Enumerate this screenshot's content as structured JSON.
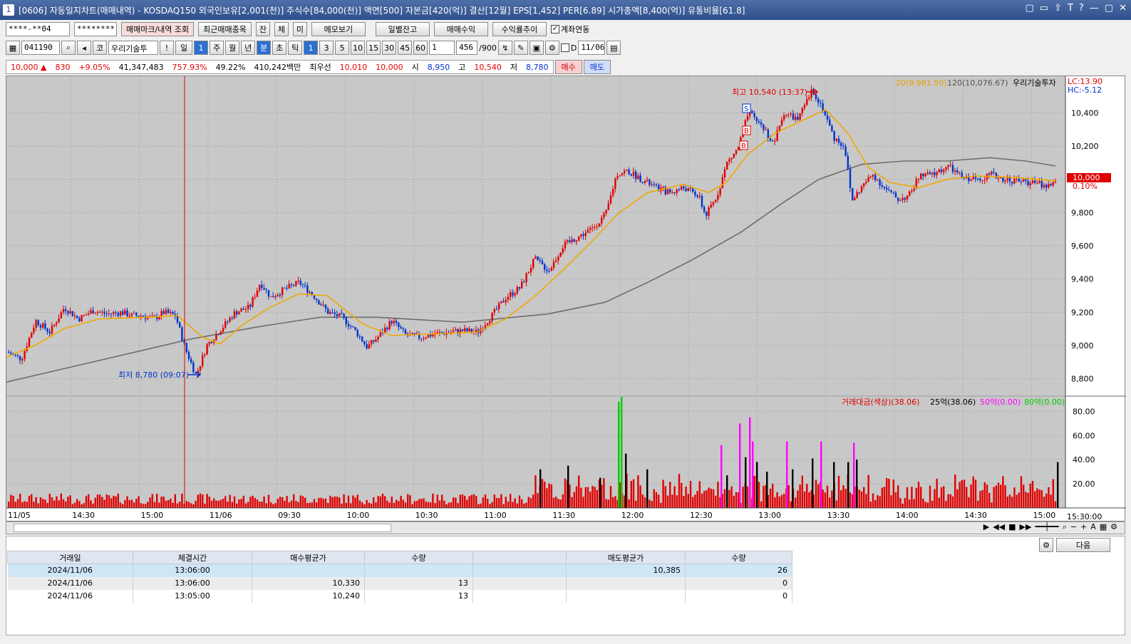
{
  "window": {
    "title": "[0606] 자동일지차트(매매내역) - KOSDAQ150 외국인보유[2,001(천)] 주식수[84,000(천)] 액면[500] 자본금[420(억)] 결산[12월] EPS[1,452] PER[6.89] 시가총액[8,400(억)] 유통비율[61.8]",
    "icon": "1",
    "controls": [
      "▢",
      "▭",
      "⇧",
      "T",
      "?",
      "—",
      "▢",
      "✕"
    ]
  },
  "toolbar1": {
    "account": "****-**04",
    "password": "********",
    "b1": "매매마크/내역 조회",
    "b2": "최근매매종목",
    "b3": "잔",
    "b4": "체",
    "b5": "미",
    "b6": "메모보기",
    "b7": "일별잔고",
    "b8": "매매수익",
    "b9": "수익률추이",
    "link_label": "계좌연동",
    "link_checked": "✓"
  },
  "toolbar2": {
    "code": "041190",
    "name": "우리기술투",
    "exclaim": "!",
    "period_day": "일",
    "period_num": "1",
    "week": "주",
    "month": "월",
    "year": "년",
    "minute": "분",
    "second": "초",
    "tick": "틱",
    "intervals": [
      "1",
      "3",
      "5",
      "10",
      "15",
      "30",
      "45",
      "60"
    ],
    "custom": "1",
    "count": "456",
    "total": "/900",
    "date_flag": "D",
    "date": "11/06",
    "code_btn": "코"
  },
  "quote": {
    "price": "10,000 ▲",
    "change": "830",
    "rate": "+9.05%",
    "volume": "41,347,483",
    "vol_rate": "757.93%",
    "ratio": "49.22%",
    "amount": "410,242백만",
    "best_label": "최우선",
    "best_ask": "10,010",
    "best_bid": "10,000",
    "open_label": "시",
    "open": "8,950",
    "high_label": "고",
    "high": "10,540",
    "low_label": "저",
    "low": "8,780",
    "buy": "매수",
    "sell": "매도"
  },
  "chart_data": {
    "type": "candlestick",
    "legend": {
      "ma20": "20(9,981.50)",
      "ma120": "120(10,076.67)",
      "broker": "우리기술투자",
      "lc": "LC:13.90",
      "hc": "HC:-5.12"
    },
    "price_ticks": [
      "10,400",
      "10,200",
      "10,000",
      "9,800",
      "9,600",
      "9,400",
      "9,200",
      "9,000",
      "8,800"
    ],
    "price_range": [
      8700,
      10620
    ],
    "current_label": "10,000",
    "current_rate": "0.10%",
    "high_annot": "최고 10,540 (13:37)",
    "low_annot": "최저 8,780 (09:07)",
    "volume_legend": {
      "main": "거래대금(색상)(38.06)",
      "s1": "25억(38.06)",
      "s2": "50억(0.00)",
      "s3": "80억(0.00)"
    },
    "volume_ticks": [
      "80.00",
      "60.00",
      "40.00",
      "20.00"
    ],
    "volume_range": [
      0,
      92
    ],
    "x_ticks": [
      "11/05",
      "14:30",
      "15:00",
      "11/06",
      "09:30",
      "10:00",
      "10:30",
      "11:00",
      "11:30",
      "12:00",
      "12:30",
      "13:00",
      "13:30",
      "14:00",
      "14:30",
      "15:00"
    ],
    "x_last": "15:30:00",
    "markers": {
      "s": "S",
      "b": "B"
    },
    "price_path": [
      [
        0,
        8960
      ],
      [
        20,
        8920
      ],
      [
        40,
        9150
      ],
      [
        60,
        9080
      ],
      [
        80,
        9230
      ],
      [
        100,
        9160
      ],
      [
        120,
        9210
      ],
      [
        140,
        9190
      ],
      [
        160,
        9200
      ],
      [
        175,
        9180
      ],
      [
        190,
        9180
      ],
      [
        205,
        9160
      ],
      [
        220,
        9200
      ],
      [
        236,
        9180
      ],
      [
        250,
        8980
      ],
      [
        265,
        8820
      ],
      [
        280,
        9000
      ],
      [
        300,
        9100
      ],
      [
        320,
        9200
      ],
      [
        340,
        9230
      ],
      [
        355,
        9380
      ],
      [
        370,
        9290
      ],
      [
        390,
        9340
      ],
      [
        410,
        9380
      ],
      [
        430,
        9300
      ],
      [
        450,
        9200
      ],
      [
        470,
        9170
      ],
      [
        490,
        9080
      ],
      [
        505,
        8990
      ],
      [
        520,
        9050
      ],
      [
        540,
        9150
      ],
      [
        560,
        9060
      ],
      [
        580,
        9050
      ],
      [
        600,
        9070
      ],
      [
        620,
        9080
      ],
      [
        640,
        9090
      ],
      [
        660,
        9080
      ],
      [
        680,
        9180
      ],
      [
        700,
        9290
      ],
      [
        720,
        9350
      ],
      [
        740,
        9520
      ],
      [
        760,
        9450
      ],
      [
        780,
        9600
      ],
      [
        800,
        9650
      ],
      [
        820,
        9700
      ],
      [
        840,
        9790
      ],
      [
        855,
        10030
      ],
      [
        870,
        10050
      ],
      [
        890,
        10000
      ],
      [
        910,
        9950
      ],
      [
        930,
        9920
      ],
      [
        950,
        9950
      ],
      [
        970,
        9900
      ],
      [
        980,
        9780
      ],
      [
        995,
        9890
      ],
      [
        1010,
        10100
      ],
      [
        1025,
        10180
      ],
      [
        1040,
        10400
      ],
      [
        1060,
        10320
      ],
      [
        1075,
        10210
      ],
      [
        1090,
        10400
      ],
      [
        1110,
        10360
      ],
      [
        1130,
        10540
      ],
      [
        1145,
        10420
      ],
      [
        1160,
        10250
      ],
      [
        1175,
        10200
      ],
      [
        1185,
        9870
      ],
      [
        1200,
        9960
      ],
      [
        1215,
        10030
      ],
      [
        1230,
        9950
      ],
      [
        1250,
        9880
      ],
      [
        1265,
        9900
      ],
      [
        1280,
        10020
      ],
      [
        1300,
        10030
      ],
      [
        1320,
        10080
      ],
      [
        1340,
        10010
      ],
      [
        1360,
        10000
      ],
      [
        1380,
        10030
      ],
      [
        1400,
        10000
      ],
      [
        1420,
        9990
      ],
      [
        1440,
        9980
      ],
      [
        1460,
        9960
      ],
      [
        1472,
        9990
      ]
    ],
    "ma20_path": [
      [
        0,
        8930
      ],
      [
        40,
        9000
      ],
      [
        80,
        9100
      ],
      [
        130,
        9160
      ],
      [
        200,
        9170
      ],
      [
        240,
        9180
      ],
      [
        275,
        9050
      ],
      [
        300,
        9010
      ],
      [
        330,
        9120
      ],
      [
        370,
        9230
      ],
      [
        410,
        9310
      ],
      [
        450,
        9300
      ],
      [
        500,
        9130
      ],
      [
        540,
        9060
      ],
      [
        600,
        9070
      ],
      [
        660,
        9080
      ],
      [
        700,
        9160
      ],
      [
        740,
        9290
      ],
      [
        780,
        9450
      ],
      [
        820,
        9620
      ],
      [
        860,
        9800
      ],
      [
        900,
        9920
      ],
      [
        950,
        9970
      ],
      [
        985,
        9920
      ],
      [
        1010,
        9980
      ],
      [
        1040,
        10150
      ],
      [
        1080,
        10280
      ],
      [
        1120,
        10360
      ],
      [
        1150,
        10420
      ],
      [
        1180,
        10280
      ],
      [
        1210,
        10070
      ],
      [
        1240,
        9980
      ],
      [
        1280,
        9950
      ],
      [
        1320,
        10000
      ],
      [
        1360,
        10020
      ],
      [
        1420,
        10010
      ],
      [
        1472,
        9990
      ]
    ],
    "ma120_path": [
      [
        0,
        8780
      ],
      [
        100,
        8880
      ],
      [
        200,
        8980
      ],
      [
        260,
        9040
      ],
      [
        350,
        9110
      ],
      [
        440,
        9170
      ],
      [
        520,
        9170
      ],
      [
        640,
        9140
      ],
      [
        760,
        9190
      ],
      [
        840,
        9260
      ],
      [
        900,
        9380
      ],
      [
        960,
        9510
      ],
      [
        1030,
        9680
      ],
      [
        1090,
        9860
      ],
      [
        1140,
        10000
      ],
      [
        1200,
        10090
      ],
      [
        1260,
        10110
      ],
      [
        1320,
        10110
      ],
      [
        1380,
        10130
      ],
      [
        1430,
        10110
      ],
      [
        1472,
        10080
      ]
    ]
  },
  "grid": {
    "headers": [
      "거래일",
      "체결시간",
      "매수평균가",
      "수량",
      "",
      "매도평균가",
      "수량"
    ],
    "rows": [
      [
        "2024/11/06",
        "13:06:00",
        "",
        "",
        "",
        "10,385",
        "26"
      ],
      [
        "2024/11/06",
        "13:06:00",
        "10,330",
        "13",
        "",
        "",
        "0"
      ],
      [
        "2024/11/06",
        "13:05:00",
        "10,240",
        "13",
        "",
        "",
        "0"
      ]
    ],
    "next": "다음"
  }
}
